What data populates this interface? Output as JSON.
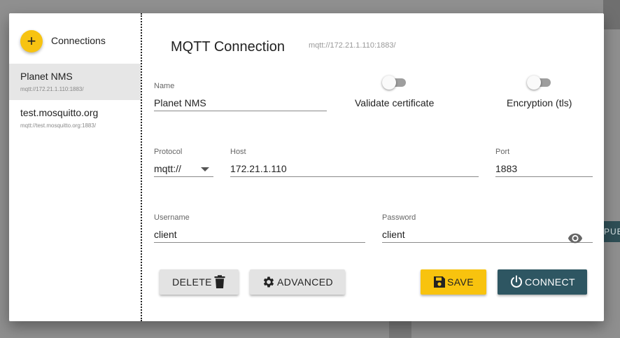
{
  "sidebar": {
    "add_icon": "plus-icon",
    "title": "Connections",
    "items": [
      {
        "name": "Planet NMS",
        "url": "mqtt://172.21.1.110:1883/",
        "active": true
      },
      {
        "name": "test.mosquitto.org",
        "url": "mqtt://test.mosquitto.org:1883/",
        "active": false
      }
    ]
  },
  "main": {
    "title": "MQTT Connection",
    "url": "mqtt://172.21.1.110:1883/"
  },
  "form": {
    "name": {
      "label": "Name",
      "value": "Planet NMS"
    },
    "validate_certificate": {
      "label": "Validate certificate",
      "on": false
    },
    "encryption": {
      "label": "Encryption (tls)",
      "on": false
    },
    "protocol": {
      "label": "Protocol",
      "value": "mqtt://"
    },
    "host": {
      "label": "Host",
      "value": "172.21.1.110"
    },
    "port": {
      "label": "Port",
      "value": "1883"
    },
    "username": {
      "label": "Username",
      "value": "client"
    },
    "password": {
      "label": "Password",
      "value": "client",
      "icon": "eye-icon"
    }
  },
  "actions": {
    "delete_label": "DELETE",
    "advanced_label": "ADVANCED",
    "save_label": "SAVE",
    "connect_label": "CONNECT"
  },
  "background": {
    "pub_label": "PUB"
  },
  "colors": {
    "accent_yellow": "#f8c30e",
    "connect_teal": "#2e5662",
    "active_item": "#e6e6e6"
  }
}
